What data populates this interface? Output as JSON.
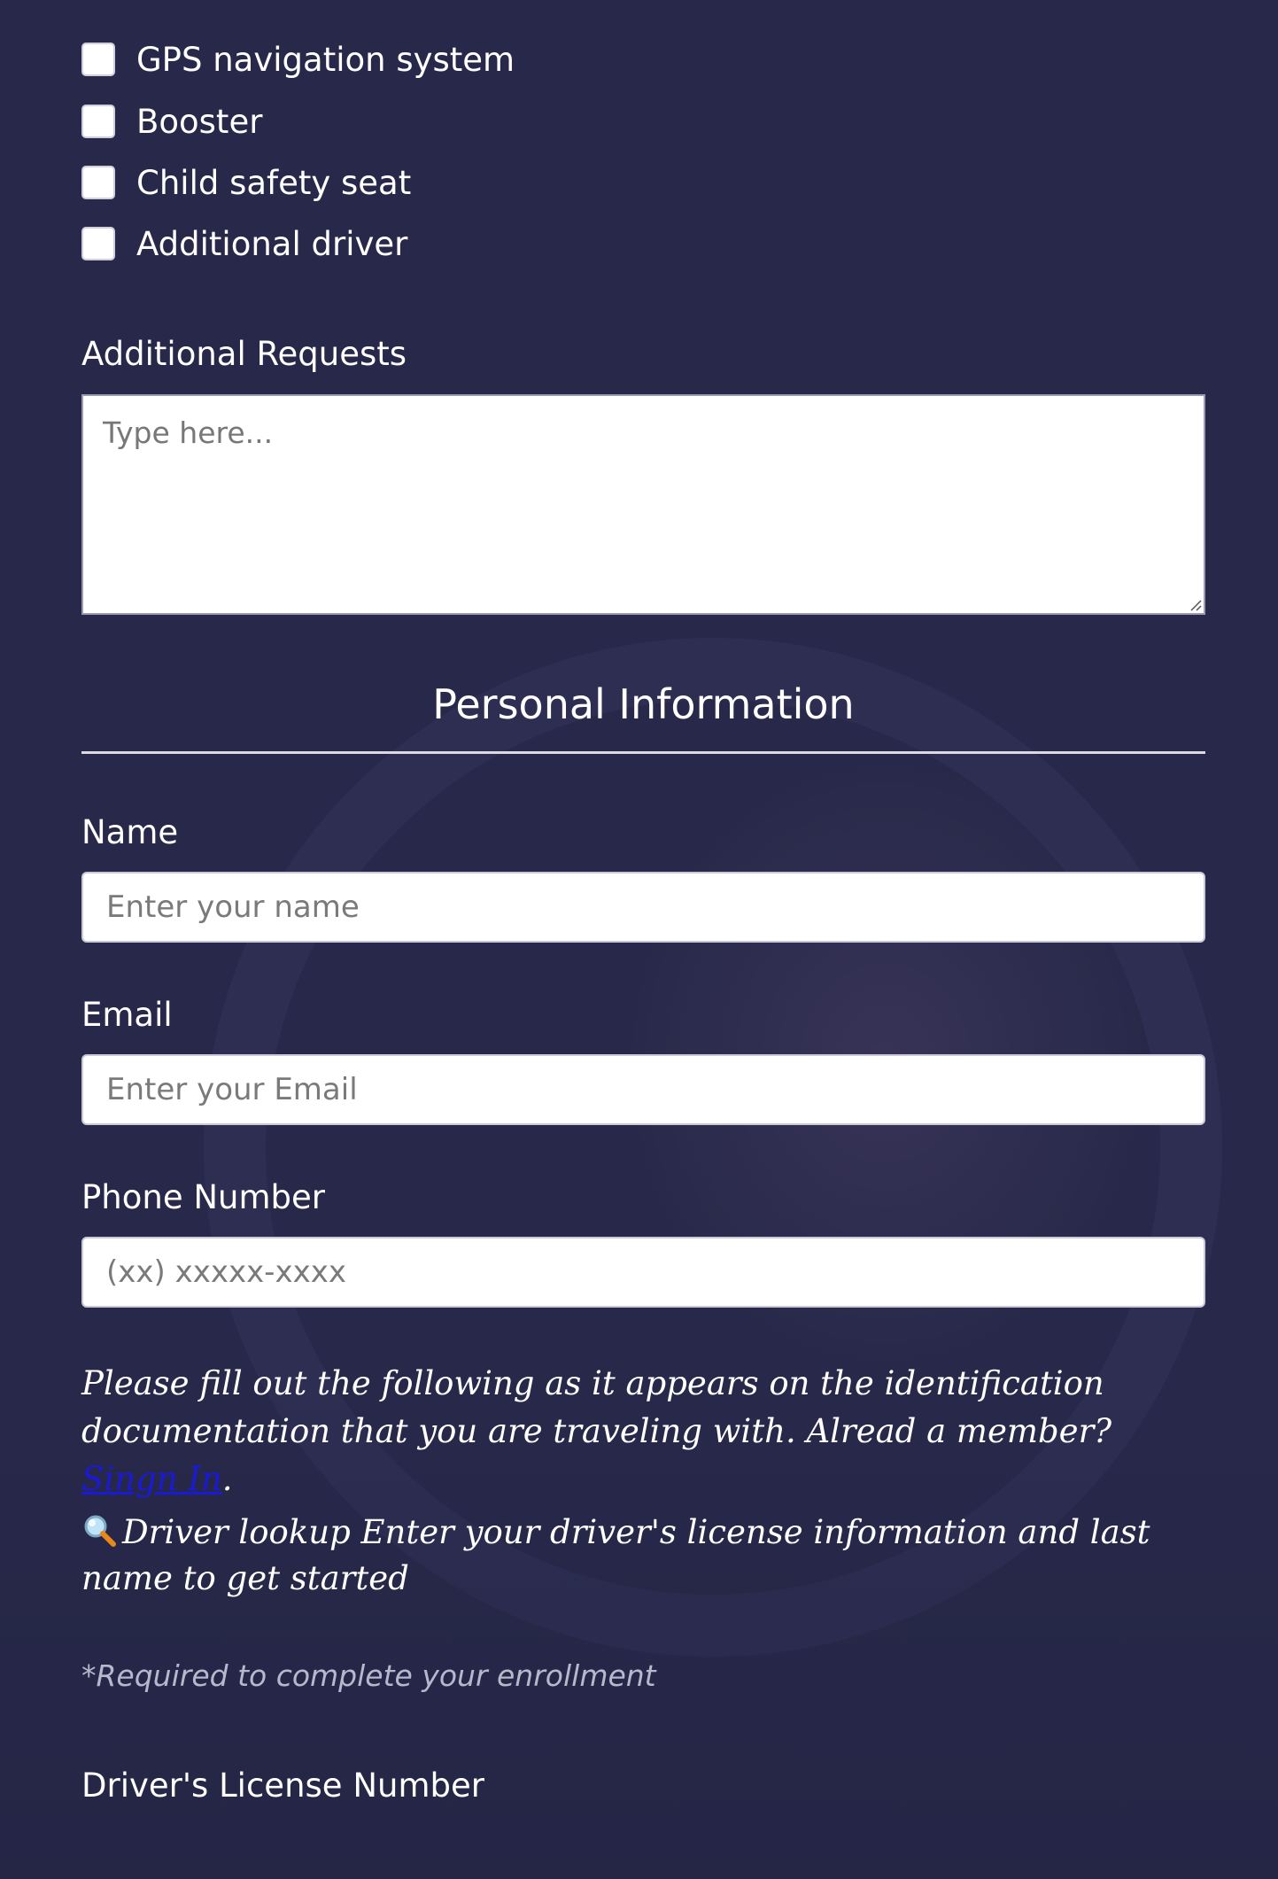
{
  "extras": {
    "options": [
      {
        "label": "GPS navigation system",
        "checked": false
      },
      {
        "label": "Booster",
        "checked": false
      },
      {
        "label": "Child safety seat",
        "checked": false
      },
      {
        "label": "Additional driver",
        "checked": false
      }
    ]
  },
  "requests": {
    "label": "Additional Requests",
    "placeholder": "Type here...",
    "value": ""
  },
  "personal": {
    "title": "Personal Information",
    "name": {
      "label": "Name",
      "placeholder": "Enter your name",
      "value": ""
    },
    "email": {
      "label": "Email",
      "placeholder": "Enter your Email",
      "value": ""
    },
    "phone": {
      "label": "Phone Number",
      "placeholder": "(xx) xxxxx-xxxx",
      "value": ""
    }
  },
  "identification_note": {
    "text": "Please fill out the following as it appears on the identification documentation that you are traveling with. Alread a member? ",
    "link_text": "Singn In",
    "suffix": "."
  },
  "lookup": {
    "icon": "magnifying-glass-icon",
    "text": "Driver lookup Enter your driver's license information and last name to get started"
  },
  "required_note": "*Required to complete your enrollment",
  "license": {
    "label": "Driver's License Number"
  },
  "colors": {
    "background": "#28294a",
    "link": "#1a1ad6",
    "muted_text": "#b7b8cc"
  }
}
